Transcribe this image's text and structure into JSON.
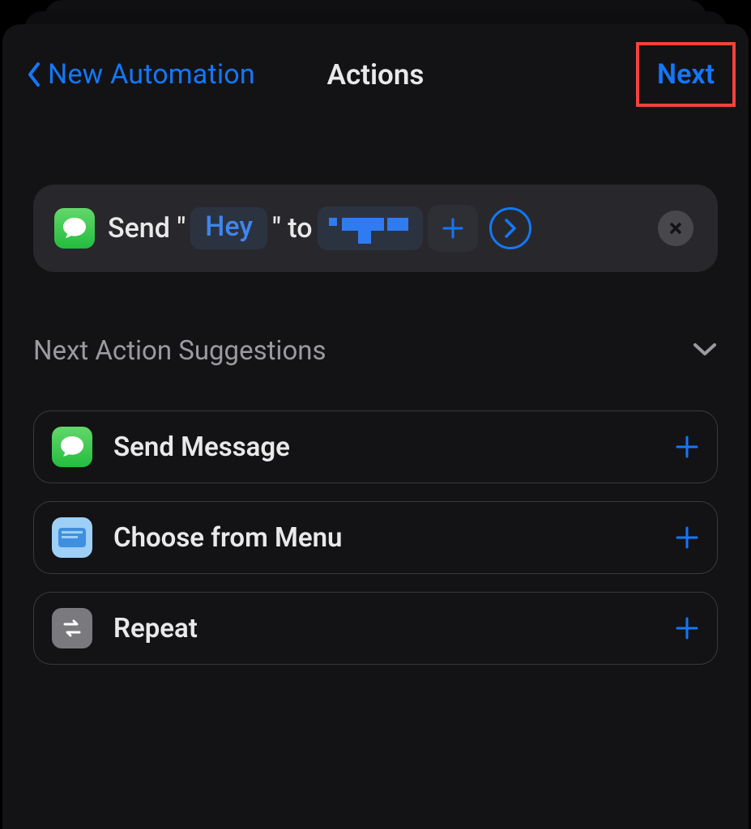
{
  "header": {
    "back_label": "New Automation",
    "title": "Actions",
    "next_label": "Next"
  },
  "action": {
    "prefix": "Send \"",
    "message_chip": "Hey",
    "middle": "\" to",
    "recipient_redacted": true
  },
  "section": {
    "title": "Next Action Suggestions"
  },
  "suggestions": [
    {
      "icon": "messages",
      "label": "Send Message"
    },
    {
      "icon": "menu",
      "label": "Choose from Menu"
    },
    {
      "icon": "repeat",
      "label": "Repeat"
    }
  ]
}
